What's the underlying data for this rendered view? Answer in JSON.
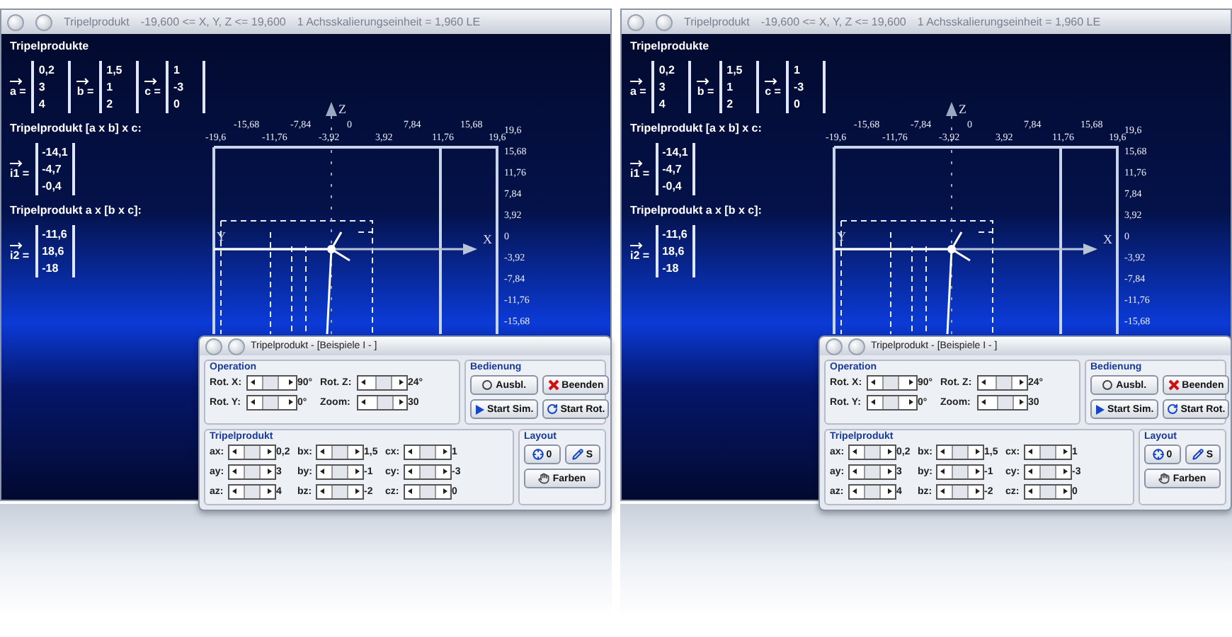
{
  "screens": [
    {
      "window": {
        "title_parts": [
          "Tripelprodukt",
          "-19,600 <= X, Y, Z <= 19,600",
          "1 Achsskalierungseinheit = 1,960 LE"
        ]
      },
      "sidebar": {
        "heading": "Tripelprodukte",
        "vectors": [
          {
            "name": "a =",
            "values": [
              "0,2",
              "3",
              "4"
            ]
          },
          {
            "name": "b =",
            "values": [
              "1,5",
              "1",
              "2"
            ]
          },
          {
            "name": "c =",
            "values": [
              "1",
              "-3",
              "0"
            ]
          }
        ],
        "results": [
          {
            "heading": "Tripelprodukt [a x b] x c:",
            "name": "i1 =",
            "values": [
              "-14,1",
              "-4,7",
              "-0,4"
            ]
          },
          {
            "heading": "Tripelprodukt a x [b x c]:",
            "name": "i2 =",
            "values": [
              "-11,6",
              "18,6",
              "-18"
            ]
          }
        ]
      },
      "axes": {
        "x_label": "X",
        "y_label": "Y",
        "z_label": "Z",
        "top_ticks": [
          "-19,6",
          "-15,68",
          "-11,76",
          "-7,84",
          "-3,92",
          "0",
          "3,92",
          "7,84",
          "11,76",
          "15,68",
          "19,6"
        ],
        "side_ticks": [
          "19,6",
          "15,68",
          "11,76",
          "7,84",
          "3,92",
          "0",
          "-3,92",
          "-7,84",
          "-11,76",
          "-15,68"
        ]
      },
      "dialog": {
        "title": "Tripelprodukt - [Beispiele I - ]",
        "operation": {
          "title": "Operation",
          "sliders": [
            {
              "label": "Rot. X:",
              "reading": "90°",
              "level": 0.45
            },
            {
              "label": "Rot. Z:",
              "reading": "24°",
              "level": 0.55
            },
            {
              "label": "Rot. Y:",
              "reading": "0°",
              "level": 0.45
            },
            {
              "label": "Zoom:",
              "reading": "30",
              "level": 0.6
            }
          ]
        },
        "controls": {
          "title": "Bedienung",
          "buttons": [
            {
              "label": "Ausbl.",
              "kind": "eye"
            },
            {
              "label": "Beenden",
              "kind": "close"
            },
            {
              "label": "Start Sim.",
              "kind": "play"
            },
            {
              "label": "Start Rot.",
              "kind": "rotate"
            }
          ]
        },
        "components": {
          "title": "Tripelprodukt",
          "columns": [
            [
              {
                "label": "ax:",
                "reading": "0,2",
                "level": 0.5
              },
              {
                "label": "ay:",
                "reading": "3",
                "level": 0.5
              },
              {
                "label": "az:",
                "reading": "4",
                "level": 0.5
              }
            ],
            [
              {
                "label": "bx:",
                "reading": "1,5",
                "level": 0.5
              },
              {
                "label": "by:",
                "reading": "-1",
                "level": 0.5
              },
              {
                "label": "bz:",
                "reading": "-2",
                "level": 0.5
              }
            ],
            [
              {
                "label": "cx:",
                "reading": "1",
                "level": 0.5
              },
              {
                "label": "cy:",
                "reading": "-3",
                "level": 0.5
              },
              {
                "label": "cz:",
                "reading": "0",
                "level": 0.5
              }
            ]
          ]
        },
        "layout": {
          "title": "Layout",
          "buttons": [
            {
              "label": "0",
              "kind": "origin"
            },
            {
              "label": "S",
              "kind": "pen"
            },
            {
              "label": "Farben",
              "kind": "colors"
            }
          ]
        }
      }
    },
    {
      "window": {
        "title_parts": [
          "Tripelprodukt",
          "-19,600 <= X, Y, Z <= 19,600",
          "1 Achsskalierungseinheit = 1,960 LE"
        ]
      },
      "sidebar": {
        "heading": "Tripelprodukte",
        "vectors": [
          {
            "name": "a =",
            "values": [
              "0,2",
              "3",
              "4"
            ]
          },
          {
            "name": "b =",
            "values": [
              "1,5",
              "1",
              "2"
            ]
          },
          {
            "name": "c =",
            "values": [
              "1",
              "-3",
              "0"
            ]
          }
        ],
        "results": [
          {
            "heading": "Tripelprodukt [a x b] x c:",
            "name": "i1 =",
            "values": [
              "-14,1",
              "-4,7",
              "-0,4"
            ]
          },
          {
            "heading": "Tripelprodukt a x [b x c]:",
            "name": "i2 =",
            "values": [
              "-11,6",
              "18,6",
              "-18"
            ]
          }
        ]
      },
      "axes": {
        "x_label": "X",
        "y_label": "Y",
        "z_label": "Z",
        "top_ticks": [
          "-19,6",
          "-15,68",
          "-11,76",
          "-7,84",
          "-3,92",
          "0",
          "3,92",
          "7,84",
          "11,76",
          "15,68",
          "19,6"
        ],
        "side_ticks": [
          "19,6",
          "15,68",
          "11,76",
          "7,84",
          "3,92",
          "0",
          "-3,92",
          "-7,84",
          "-11,76",
          "-15,68"
        ]
      },
      "dialog": {
        "title": "Tripelprodukt - [Beispiele I - ]",
        "operation": {
          "title": "Operation",
          "sliders": [
            {
              "label": "Rot. X:",
              "reading": "90°",
              "level": 0.45
            },
            {
              "label": "Rot. Z:",
              "reading": "24°",
              "level": 0.55
            },
            {
              "label": "Rot. Y:",
              "reading": "0°",
              "level": 0.45
            },
            {
              "label": "Zoom:",
              "reading": "30",
              "level": 0.6
            }
          ]
        },
        "controls": {
          "title": "Bedienung",
          "buttons": [
            {
              "label": "Ausbl.",
              "kind": "eye"
            },
            {
              "label": "Beenden",
              "kind": "close"
            },
            {
              "label": "Start Sim.",
              "kind": "play"
            },
            {
              "label": "Start Rot.",
              "kind": "rotate"
            }
          ]
        },
        "components": {
          "title": "Tripelprodukt",
          "columns": [
            [
              {
                "label": "ax:",
                "reading": "0,2",
                "level": 0.5
              },
              {
                "label": "ay:",
                "reading": "3",
                "level": 0.5
              },
              {
                "label": "az:",
                "reading": "4",
                "level": 0.5
              }
            ],
            [
              {
                "label": "bx:",
                "reading": "1,5",
                "level": 0.5
              },
              {
                "label": "by:",
                "reading": "-1",
                "level": 0.5
              },
              {
                "label": "bz:",
                "reading": "-2",
                "level": 0.5
              }
            ],
            [
              {
                "label": "cx:",
                "reading": "1",
                "level": 0.5
              },
              {
                "label": "cy:",
                "reading": "-3",
                "level": 0.5
              },
              {
                "label": "cz:",
                "reading": "0",
                "level": 0.5
              }
            ]
          ]
        },
        "layout": {
          "title": "Layout",
          "buttons": [
            {
              "label": "0",
              "kind": "origin"
            },
            {
              "label": "S",
              "kind": "pen"
            },
            {
              "label": "Farben",
              "kind": "colors"
            }
          ]
        }
      }
    }
  ]
}
